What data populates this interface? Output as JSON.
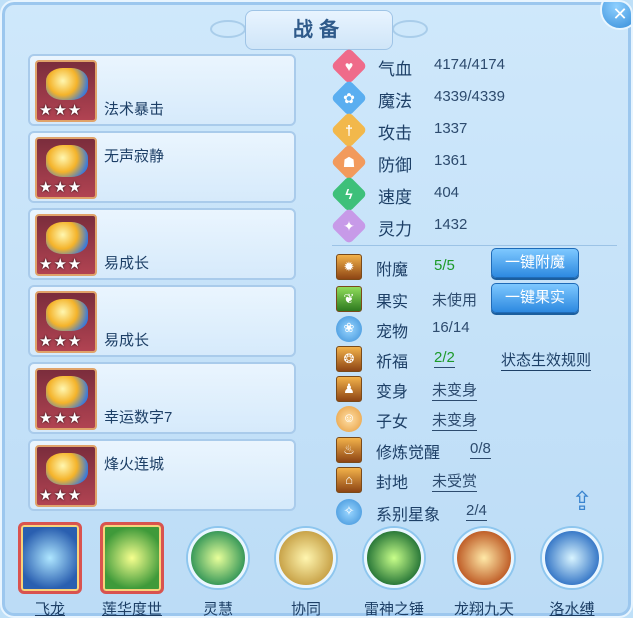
{
  "window": {
    "title": "战备",
    "close_icon": "✕"
  },
  "equipment": [
    {
      "name": "法术暴击",
      "stars": "★★★"
    },
    {
      "name": "无声寂静",
      "stars": "★★★"
    },
    {
      "name": "易成长",
      "stars": "★★★"
    },
    {
      "name": "易成长",
      "stars": "★★★"
    },
    {
      "name": "幸运数字7",
      "stars": "★★★"
    },
    {
      "name": "烽火连城",
      "stars": "★★★"
    }
  ],
  "stats": [
    {
      "label": "气血",
      "value": "4174/4174",
      "icon": "heart-icon",
      "color": "#ef6b8a"
    },
    {
      "label": "魔法",
      "value": "4339/4339",
      "icon": "paw-icon",
      "color": "#5aaef0"
    },
    {
      "label": "攻击",
      "value": "1337",
      "icon": "sword-icon",
      "color": "#f2b84b"
    },
    {
      "label": "防御",
      "value": "1361",
      "icon": "person-icon",
      "color": "#f29a5c"
    },
    {
      "label": "速度",
      "value": "404",
      "icon": "bolt-icon",
      "color": "#3ec07a"
    },
    {
      "label": "灵力",
      "value": "1432",
      "icon": "spark-icon",
      "color": "#c79ae8"
    }
  ],
  "attributes": {
    "enchant": {
      "label": "附魔",
      "value": "5/5"
    },
    "fruit": {
      "label": "果实",
      "value": "未使用"
    },
    "pet": {
      "label": "宠物",
      "value": "16/14"
    },
    "blessing": {
      "label": "祈福",
      "value": "2/2"
    },
    "transform": {
      "label": "变身",
      "value": "未变身"
    },
    "children": {
      "label": "子女",
      "value": "未变身"
    },
    "cultivation": {
      "label": "修炼觉醒",
      "value": "0/8"
    },
    "fief": {
      "label": "封地",
      "value": "未受赏"
    },
    "star": {
      "label": "系别星象",
      "value": "2/4"
    }
  },
  "buttons": {
    "enchant_all": "一键附魔",
    "fruit_all": "一键果实",
    "status_rules": "状态生效规则"
  },
  "skills": [
    {
      "name": "飞龙"
    },
    {
      "name": "莲华度世"
    },
    {
      "name": "灵慧"
    },
    {
      "name": "协同"
    },
    {
      "name": "雷神之锤"
    },
    {
      "name": "龙翔九天"
    },
    {
      "name": "洛水缚"
    }
  ]
}
